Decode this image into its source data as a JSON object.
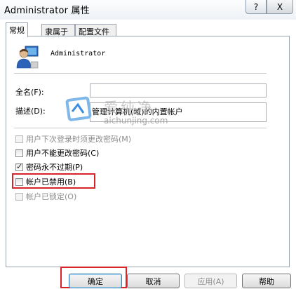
{
  "window": {
    "title": "Administrator 属性",
    "help_glyph": "?",
    "close_glyph": "X"
  },
  "tabs": [
    {
      "label": "常规",
      "active": true
    },
    {
      "label": "隶属于",
      "active": false
    },
    {
      "label": "配置文件",
      "active": false
    }
  ],
  "user": {
    "name": "Administrator"
  },
  "fields": {
    "fullname_label": "全名(F):",
    "fullname_value": "",
    "desc_label": "描述(D):",
    "desc_value": "管理计算机(域)的内置帐户"
  },
  "checkboxes": [
    {
      "label": "用户下次登录时须更改密码(M)",
      "checked": false,
      "enabled": false
    },
    {
      "label": "用户不能更改密码(C)",
      "checked": false,
      "enabled": true
    },
    {
      "label": "密码永不过期(P)",
      "checked": true,
      "enabled": true
    },
    {
      "label": "帐户已禁用(B)",
      "checked": false,
      "enabled": true
    },
    {
      "label": "帐户已锁定(O)",
      "checked": false,
      "enabled": false
    }
  ],
  "buttons": {
    "ok": "确定",
    "cancel": "取消",
    "apply": "应用(A)",
    "help": "帮助"
  },
  "watermark": {
    "text": "爱纯净",
    "url": "aichunjing.com"
  },
  "colors": {
    "highlight": "#d7232a",
    "border": "#9aa4b0"
  }
}
